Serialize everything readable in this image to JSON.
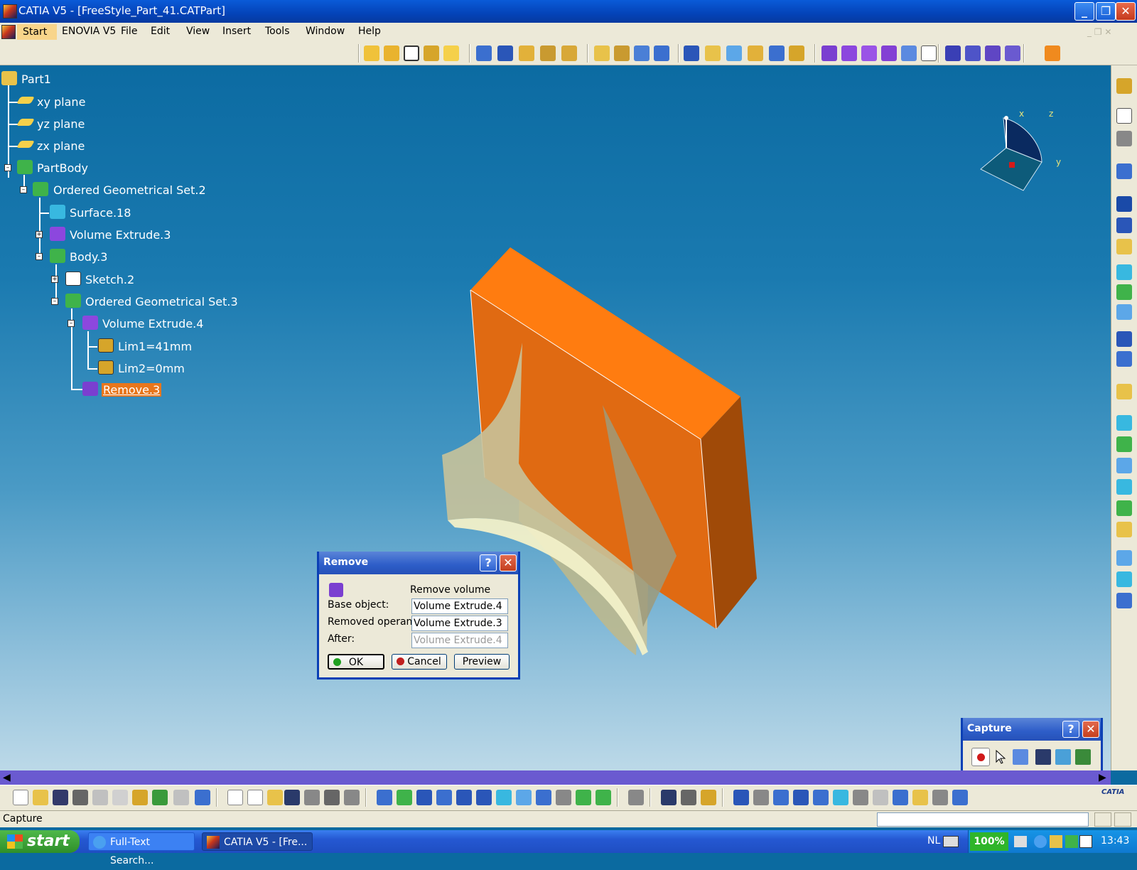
{
  "window": {
    "title": "CATIA V5 - [FreeStyle_Part_41.CATPart]",
    "minimize": "_",
    "maximize": "❐",
    "close": "✕"
  },
  "menu": {
    "start": "Start",
    "enovia": "ENOVIA V5",
    "file": "File",
    "edit": "Edit",
    "view": "View",
    "insert": "Insert",
    "tools": "Tools",
    "window": "Window",
    "help": "Help"
  },
  "tree": {
    "part1": "Part1",
    "xy": "xy plane",
    "yz": "yz plane",
    "zx": "zx plane",
    "partbody": "PartBody",
    "ogs2": "Ordered Geometrical Set.2",
    "surface18": "Surface.18",
    "volext3": "Volume Extrude.3",
    "body3": "Body.3",
    "sketch2": "Sketch.2",
    "ogs3": "Ordered Geometrical Set.3",
    "volext4": "Volume Extrude.4",
    "lim1": "Lim1=41mm",
    "lim2": "Lim2=0mm",
    "remove3": "Remove.3"
  },
  "compass": {
    "z": "z",
    "y": "y",
    "x": "x"
  },
  "remove_dialog": {
    "title": "Remove",
    "help": "?",
    "close": "✕",
    "subtitle": "Remove volume",
    "base_label": "Base object:",
    "base_value": "Volume Extrude.4",
    "removed_label": "Removed operand",
    "removed_value": "Volume Extrude.3",
    "after_label": "After:",
    "after_value": "Volume Extrude.4",
    "ok": "OK",
    "cancel": "Cancel",
    "preview": "Preview"
  },
  "capture_dialog": {
    "title": "Capture",
    "help": "?",
    "close": "✕"
  },
  "status": {
    "text": "Capture"
  },
  "taskbar": {
    "start": "start",
    "task1": "Full-Text Search...",
    "task2": "CATIA V5 - [Fre...",
    "lang": "NL",
    "zoom": "100%",
    "clock": "13:43"
  },
  "colors": {
    "accent_orange": "#e8761c",
    "viewport_top": "#0c6ba2",
    "xp_blue": "#2558d2"
  }
}
